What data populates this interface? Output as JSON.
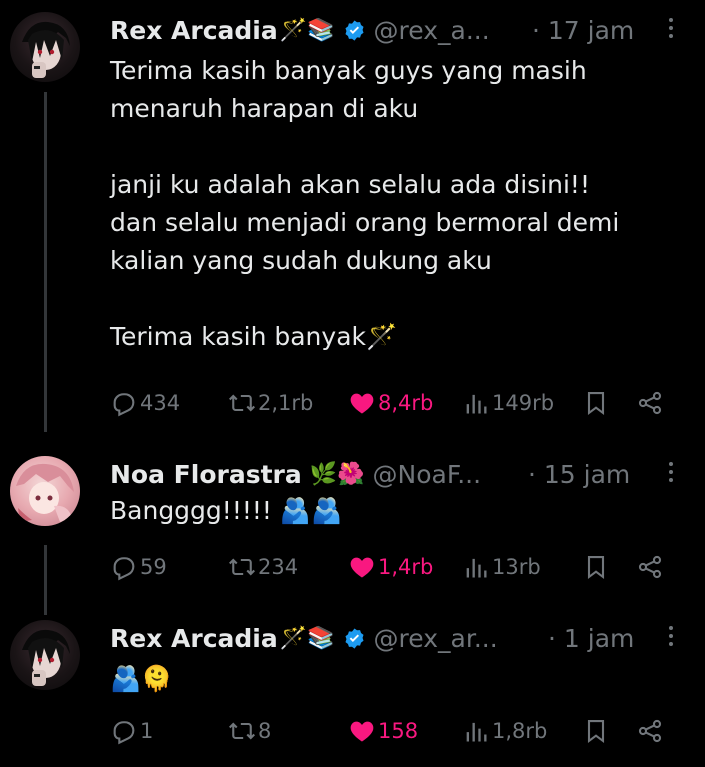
{
  "posts": [
    {
      "author": "Rex Arcadia",
      "author_emoji": "🪄📚",
      "verified": true,
      "handle": "@rex_a...",
      "time": "· 17 jam",
      "text": "Terima kasih banyak guys yang masih\nmenaruh harapan di aku\n\njanji ku adalah akan selalu ada disini!!\ndan selalu menjadi orang bermoral demi\nkalian yang sudah dukung aku\n\nTerima kasih banyak🪄",
      "replies": "434",
      "reposts": "2,1rb",
      "likes": "8,4rb",
      "views": "149rb"
    },
    {
      "author": "Noa Florastra",
      "author_emoji": "🌿🌺",
      "verified": false,
      "handle": "@NoaF...",
      "time": "· 15 jam",
      "text": "Bangggg!!!!! 🫂🫂",
      "replies": "59",
      "reposts": "234",
      "likes": "1,4rb",
      "views": "13rb"
    },
    {
      "author": "Rex Arcadia",
      "author_emoji": "🪄📚",
      "verified": true,
      "handle": "@rex_ar...",
      "time": "· 1 jam",
      "text": "🫂🫠",
      "replies": "1",
      "reposts": "8",
      "likes": "158",
      "views": "1,8rb"
    }
  ],
  "colors": {
    "background": "#000000",
    "text": "#e7e9ea",
    "muted": "#71767b",
    "like": "#f91880",
    "verified": "#1d9bf0"
  },
  "icons": [
    "reply-icon",
    "repost-icon",
    "like-icon",
    "views-icon",
    "bookmark-icon",
    "share-icon",
    "more-icon",
    "verified-badge-icon"
  ]
}
